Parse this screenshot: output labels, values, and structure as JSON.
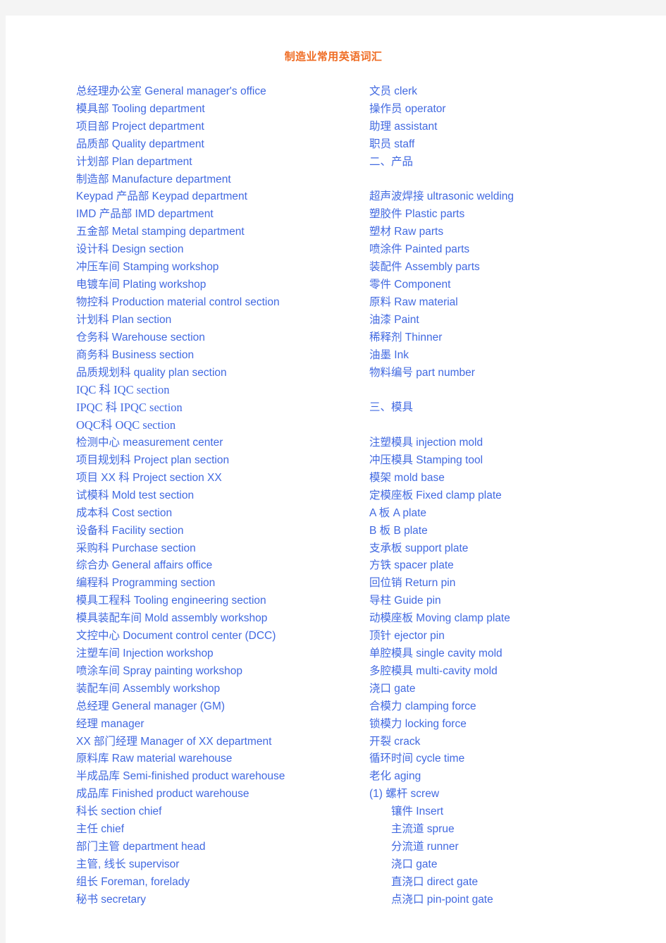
{
  "document": {
    "title": "制造业常用英语词汇",
    "title_color": "#ef6c23",
    "text_color": "#4169e1",
    "page_background": "#ffffff",
    "canvas_background": "#f4f4f4"
  },
  "columns": {
    "left": [
      {
        "text": "总经理办公室 General manager's office",
        "style": "normal"
      },
      {
        "text": "模具部 Tooling department",
        "style": "normal"
      },
      {
        "text": "项目部 Project department",
        "style": "normal"
      },
      {
        "text": "品质部 Quality department",
        "style": "normal"
      },
      {
        "text": "计划部 Plan department",
        "style": "normal"
      },
      {
        "text": "制造部 Manufacture department",
        "style": "normal"
      },
      {
        "text": "Keypad 产品部 Keypad department",
        "style": "normal"
      },
      {
        "text": "IMD 产品部 IMD department",
        "style": "normal"
      },
      {
        "text": "五金部 Metal stamping department",
        "style": "normal"
      },
      {
        "text": "设计科 Design section",
        "style": "normal"
      },
      {
        "text": "冲压车间 Stamping workshop",
        "style": "normal"
      },
      {
        "text": "电镀车间 Plating workshop",
        "style": "normal"
      },
      {
        "text": "物控科 Production material control section",
        "style": "normal"
      },
      {
        "text": "计划科 Plan section",
        "style": "normal"
      },
      {
        "text": "仓务科 Warehouse section",
        "style": "normal"
      },
      {
        "text": "商务科 Business section",
        "style": "normal"
      },
      {
        "text": "品质规划科 quality plan section",
        "style": "normal"
      },
      {
        "text": "IQC 科 IQC section",
        "style": "serif"
      },
      {
        "text": "IPQC 科 IPQC section",
        "style": "serif"
      },
      {
        "text": "OQC科 OQC section",
        "style": "serif"
      },
      {
        "text": "检测中心 measurement center",
        "style": "normal"
      },
      {
        "text": "项目规划科 Project plan section",
        "style": "normal"
      },
      {
        "text": "项目 XX 科 Project section XX",
        "style": "normal"
      },
      {
        "text": "试模科 Mold test section",
        "style": "normal"
      },
      {
        "text": "成本科 Cost section",
        "style": "normal"
      },
      {
        "text": "设备科 Facility section",
        "style": "normal"
      },
      {
        "text": "采购科 Purchase section",
        "style": "normal"
      },
      {
        "text": "综合办 General affairs office",
        "style": "normal"
      },
      {
        "text": "编程科 Programming section",
        "style": "normal"
      },
      {
        "text": "模具工程科 Tooling engineering section",
        "style": "normal"
      },
      {
        "text": "模具装配车间 Mold assembly workshop",
        "style": "normal"
      },
      {
        "text": "文控中心 Document control center (DCC)",
        "style": "normal"
      },
      {
        "text": "注塑车间 Injection workshop",
        "style": "normal"
      },
      {
        "text": "喷涂车间 Spray painting workshop",
        "style": "normal"
      },
      {
        "text": "装配车间 Assembly workshop",
        "style": "normal"
      },
      {
        "text": "总经理 General manager (GM)",
        "style": "normal"
      },
      {
        "text": "经理 manager",
        "style": "normal"
      },
      {
        "text": "XX 部门经理 Manager of XX department",
        "style": "normal"
      },
      {
        "text": "原料库 Raw material warehouse",
        "style": "normal"
      },
      {
        "text": "半成品库 Semi-finished product warehouse",
        "style": "normal"
      },
      {
        "text": "成品库 Finished product warehouse",
        "style": "normal"
      },
      {
        "text": "科长 section chief",
        "style": "normal"
      },
      {
        "text": "主任 chief",
        "style": "normal"
      },
      {
        "text": "部门主管 department head",
        "style": "normal"
      },
      {
        "text": "主管, 线长 supervisor",
        "style": "normal"
      },
      {
        "text": "组长 Foreman, forelady",
        "style": "normal"
      },
      {
        "text": "秘书 secretary",
        "style": "normal"
      }
    ],
    "right": [
      {
        "text": "文员 clerk",
        "style": "normal"
      },
      {
        "text": "操作员 operator",
        "style": "normal"
      },
      {
        "text": "助理 assistant",
        "style": "normal"
      },
      {
        "text": "职员 staff",
        "style": "normal"
      },
      {
        "text": "二、产品",
        "style": "normal"
      },
      {
        "text": "",
        "style": "blank"
      },
      {
        "text": "超声波焊接 ultrasonic welding",
        "style": "normal"
      },
      {
        "text": "塑胶件 Plastic parts",
        "style": "normal"
      },
      {
        "text": "塑材 Raw parts",
        "style": "normal"
      },
      {
        "text": "喷涂件 Painted parts",
        "style": "normal"
      },
      {
        "text": "装配件 Assembly parts",
        "style": "normal"
      },
      {
        "text": "零件 Component",
        "style": "normal"
      },
      {
        "text": "原料 Raw material",
        "style": "normal"
      },
      {
        "text": "油漆 Paint",
        "style": "normal"
      },
      {
        "text": "稀释剂 Thinner",
        "style": "normal"
      },
      {
        "text": "油墨 Ink",
        "style": "normal"
      },
      {
        "text": "物料编号 part number",
        "style": "normal"
      },
      {
        "text": "",
        "style": "blank"
      },
      {
        "text": "三、模具",
        "style": "normal"
      },
      {
        "text": "",
        "style": "blank"
      },
      {
        "text": "注塑模具 injection mold",
        "style": "normal"
      },
      {
        "text": "冲压模具 Stamping tool",
        "style": "normal"
      },
      {
        "text": "模架 mold base",
        "style": "normal"
      },
      {
        "text": "定模座板 Fixed clamp plate",
        "style": "normal"
      },
      {
        "text": "A 板 A plate",
        "style": "normal"
      },
      {
        "text": "B 板 B plate",
        "style": "normal"
      },
      {
        "text": "支承板 support plate",
        "style": "normal"
      },
      {
        "text": "方铁 spacer plate",
        "style": "normal"
      },
      {
        "text": "回位销 Return pin",
        "style": "normal"
      },
      {
        "text": "导柱 Guide pin",
        "style": "normal"
      },
      {
        "text": "动模座板 Moving clamp plate",
        "style": "normal"
      },
      {
        "text": "顶针 ejector pin",
        "style": "normal"
      },
      {
        "text": "单腔模具 single cavity mold",
        "style": "normal"
      },
      {
        "text": "多腔模具 multi-cavity mold",
        "style": "normal"
      },
      {
        "text": "浇口 gate",
        "style": "normal"
      },
      {
        "text": "合模力 clamping force",
        "style": "normal"
      },
      {
        "text": "锁模力 locking force",
        "style": "normal"
      },
      {
        "text": "开裂 crack",
        "style": "normal"
      },
      {
        "text": "循环时间 cycle time",
        "style": "normal"
      },
      {
        "text": "老化 aging",
        "style": "normal"
      },
      {
        "text": "(1) 螺杆 screw",
        "style": "normal"
      },
      {
        "text": "镶件 Insert",
        "style": "indent"
      },
      {
        "text": "主流道 sprue",
        "style": "indent"
      },
      {
        "text": "分流道 runner",
        "style": "indent"
      },
      {
        "text": "浇口 gate",
        "style": "indent"
      },
      {
        "text": "直浇口 direct gate",
        "style": "indent"
      },
      {
        "text": "点浇口 pin-point gate",
        "style": "indent"
      }
    ]
  }
}
